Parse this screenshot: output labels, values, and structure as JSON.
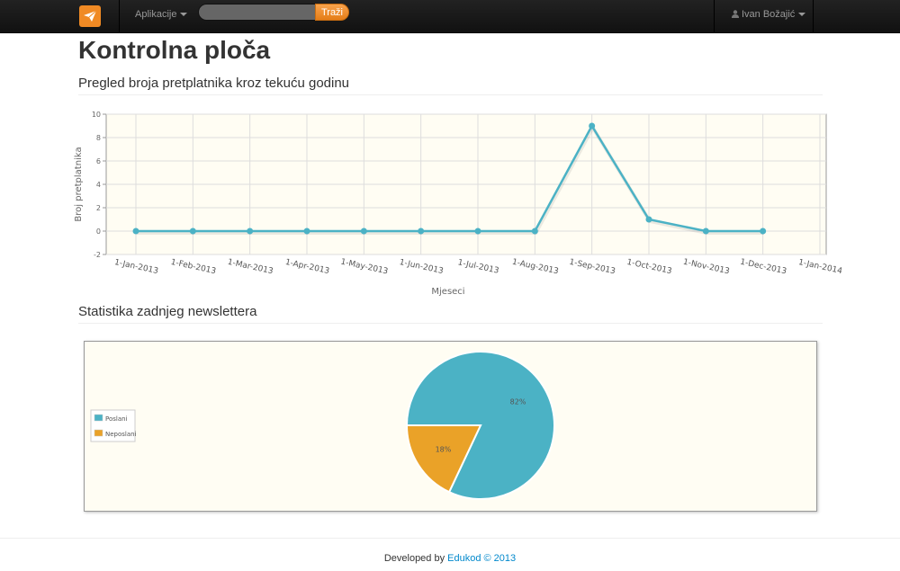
{
  "navbar": {
    "logo_icon": "paper-plane-icon",
    "apps_label": "Aplikacije",
    "search_value": "",
    "search_button": "Traži",
    "user_name": "Ivan Božajić",
    "user_icon": "user-icon"
  },
  "page": {
    "title": "Kontrolna ploča",
    "section1_title": "Pregled broja pretplatnika kroz tekuću godinu",
    "section2_title": "Statistika zadnjeg newslettera"
  },
  "footer": {
    "prefix": "Developed by ",
    "link": "Edukod © 2013"
  },
  "colors": {
    "series": "#4bb2c5",
    "slice2": "#eaa228",
    "chart_bg": "#fffdf3",
    "accent": "#f08a24"
  },
  "chart_data": [
    {
      "type": "line",
      "title": "",
      "xlabel": "Mjeseci",
      "ylabel": "Broj pretplatnika",
      "ylim": [
        -2,
        10
      ],
      "yticks": [
        "-2",
        "0",
        "2",
        "4",
        "6",
        "8",
        "10"
      ],
      "xticks": [
        "1-Jan-2013",
        "1-Feb-2013",
        "1-Mar-2013",
        "1-Apr-2013",
        "1-May-2013",
        "1-Jun-2013",
        "1-Jul-2013",
        "1-Aug-2013",
        "1-Sep-2013",
        "1-Oct-2013",
        "1-Nov-2013",
        "1-Dec-2013",
        "1-Jan-2014"
      ],
      "grid": true,
      "series": [
        {
          "values": [
            0,
            0,
            0,
            0,
            0,
            0,
            0,
            0,
            9,
            1,
            0,
            0
          ]
        }
      ]
    },
    {
      "type": "pie",
      "legend_position": "left",
      "slices": [
        {
          "name": "Poslani",
          "value": 82,
          "label": "82%"
        },
        {
          "name": "Neposlani",
          "value": 18,
          "label": "18%"
        }
      ]
    }
  ]
}
